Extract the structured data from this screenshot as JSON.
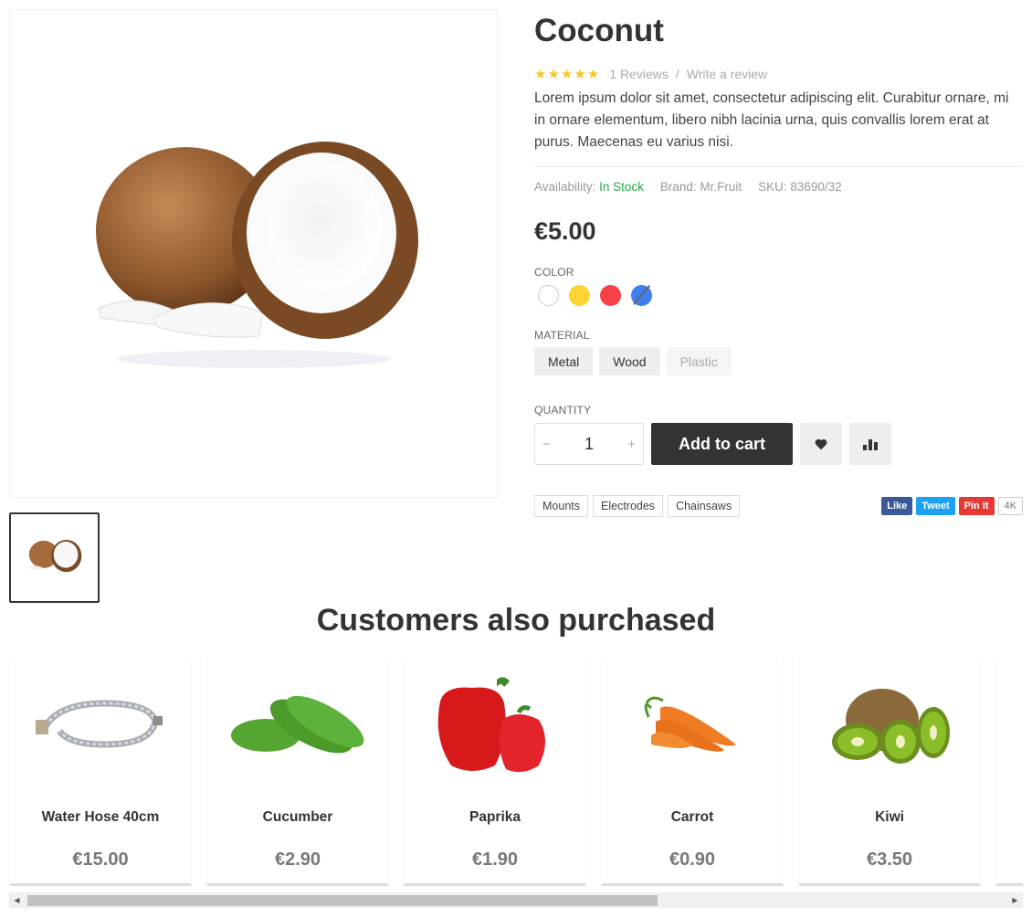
{
  "product": {
    "title": "Coconut",
    "rating": 5,
    "rating_max": 5,
    "reviews_label": "1 Reviews",
    "separator": "/",
    "write_review_label": "Write a review",
    "description": "Lorem ipsum dolor sit amet, consectetur adipiscing elit. Curabitur ornare, mi in ornare elementum, libero nibh lacinia urna, quis convallis lorem erat at purus. Maecenas eu varius nisi.",
    "availability_label": "Availability:",
    "availability_value": "In Stock",
    "brand": "Brand: Mr.Fruit",
    "sku": "SKU: 83690/32",
    "price": "€5.00",
    "color_label": "COLOR",
    "colors": [
      {
        "name": "white",
        "hex": "#ffffff",
        "available": true
      },
      {
        "name": "yellow",
        "hex": "#fdd233",
        "available": true
      },
      {
        "name": "red",
        "hex": "#f84144",
        "available": true
      },
      {
        "name": "blue",
        "hex": "#3f7ff2",
        "available": false
      }
    ],
    "material_label": "MATERIAL",
    "materials": [
      {
        "label": "Metal",
        "available": true
      },
      {
        "label": "Wood",
        "available": true
      },
      {
        "label": "Plastic",
        "available": false
      }
    ],
    "quantity_label": "QUANTITY",
    "quantity": "1",
    "minus_symbol": "−",
    "plus_symbol": "+",
    "add_to_cart_label": "Add to cart",
    "wishlist_icon": "heart-icon",
    "compare_icon": "bar-chart-icon",
    "tags": [
      "Mounts",
      "Electrodes",
      "Chainsaws"
    ],
    "share": {
      "like": "Like",
      "tweet": "Tweet",
      "pin": "Pin It",
      "count": "4K"
    }
  },
  "related": {
    "title": "Customers also purchased",
    "items": [
      {
        "name": "Water Hose 40cm",
        "price": "€15.00",
        "image": "water-hose"
      },
      {
        "name": "Cucumber",
        "price": "€2.90",
        "image": "cucumber"
      },
      {
        "name": "Paprika",
        "price": "€1.90",
        "image": "paprika"
      },
      {
        "name": "Carrot",
        "price": "€0.90",
        "image": "carrot"
      },
      {
        "name": "Kiwi",
        "price": "€3.50",
        "image": "kiwi"
      }
    ]
  },
  "scrollbar": {
    "left_arrow": "◀",
    "right_arrow": "▶",
    "position_fraction": 0.0,
    "visible_fraction": 0.63
  }
}
